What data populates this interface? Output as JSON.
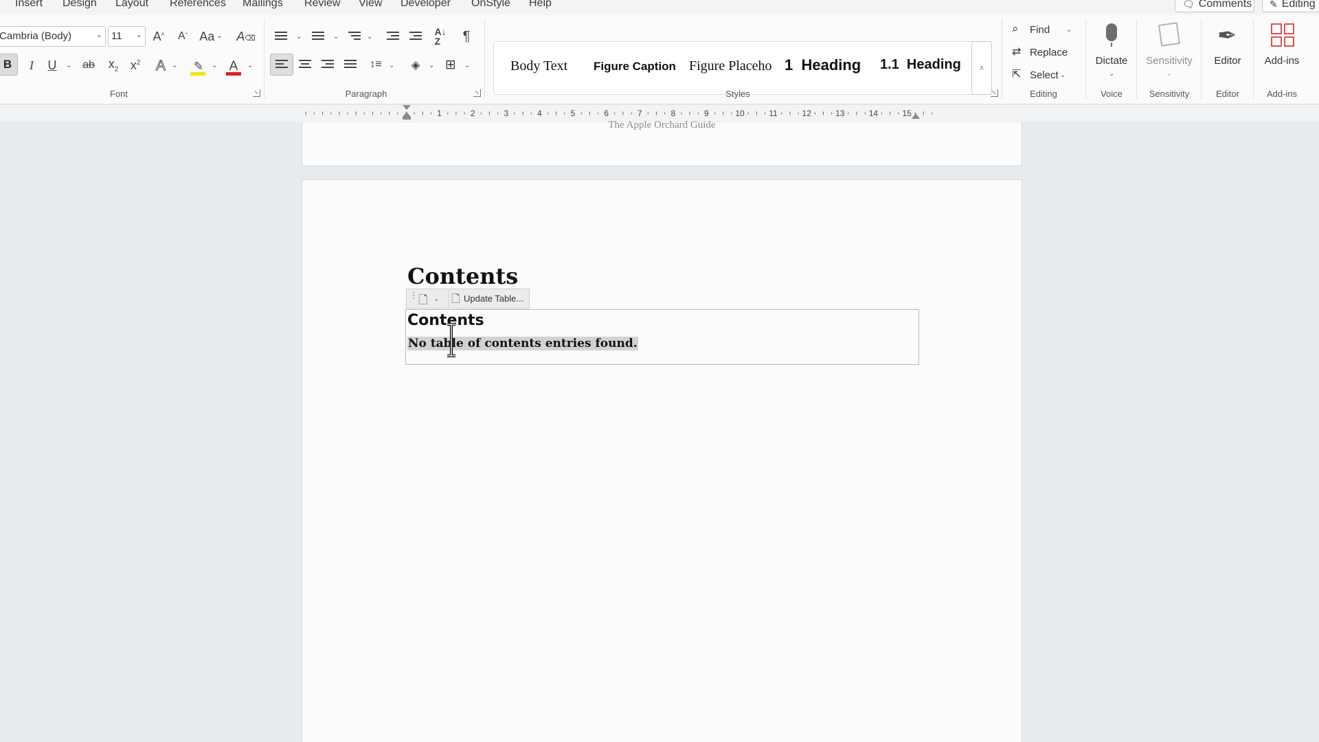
{
  "menu": {
    "tabs": [
      "Insert",
      "Design",
      "Layout",
      "References",
      "Mailings",
      "Review",
      "View",
      "Developer",
      "OnStyle",
      "Help"
    ],
    "comments_label": "Comments",
    "editing_label": "Editing"
  },
  "font": {
    "name": "Cambria (Body)",
    "size": "11",
    "group_label": "Font",
    "bold": "B",
    "italic": "I",
    "underline": "U",
    "strike": "ab",
    "subscript": "x",
    "superscript": "x",
    "change_case": "Aa",
    "grow": "A",
    "shrink": "A",
    "effects": "A",
    "highlight_color": "#f5e400",
    "font_color": "#e02020"
  },
  "paragraph": {
    "group_label": "Paragraph",
    "pilcrow": "¶"
  },
  "styles": {
    "group_label": "Styles",
    "items": [
      "Body Text",
      "Figure Caption",
      "Figure Placeho",
      "1  Heading",
      "1.1  Heading"
    ]
  },
  "editing": {
    "group_label": "Editing",
    "find": "Find",
    "replace": "Replace",
    "select": "Select"
  },
  "voice": {
    "group_label": "Voice",
    "dictate": "Dictate"
  },
  "sensitivity": {
    "group_label": "Sensitivity",
    "button": "Sensitivity"
  },
  "editor": {
    "group_label": "Editor",
    "button": "Editor"
  },
  "addins": {
    "group_label": "Add-ins",
    "button": "Add-ins"
  },
  "ruler": {
    "numbers": [
      "1",
      "2",
      "3",
      "4",
      "5",
      "6",
      "7",
      "8",
      "9",
      "10",
      "11",
      "12",
      "13",
      "14",
      "15"
    ]
  },
  "document": {
    "header_text": "The Apple Orchard Guide",
    "title": "Contents",
    "toc_update_label": "Update Table...",
    "toc_heading": "Contents",
    "toc_message": "No table of contents entries found."
  }
}
